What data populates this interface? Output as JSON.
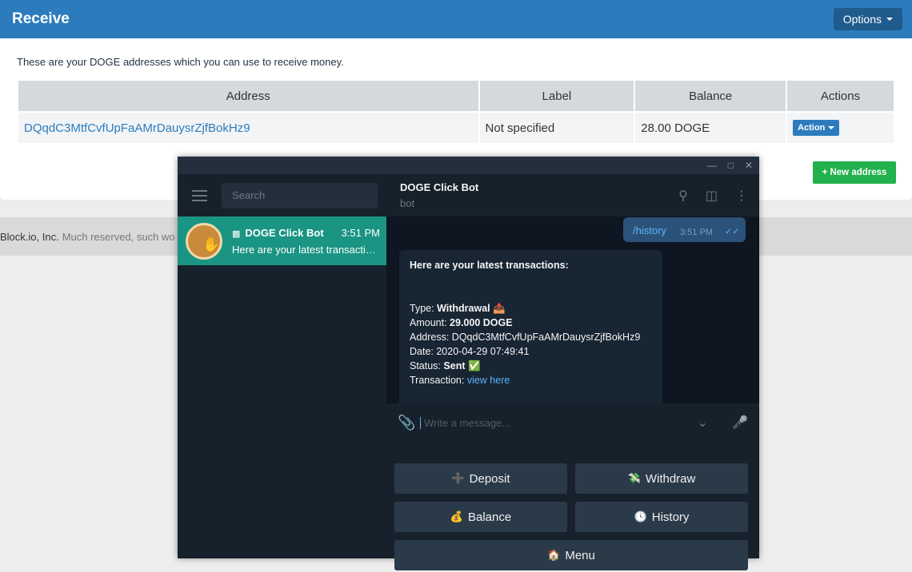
{
  "page": {
    "title": "Receive",
    "options_label": "Options",
    "intro": "These are your DOGE addresses which you can use to receive money.",
    "table": {
      "headers": [
        "Address",
        "Label",
        "Balance",
        "Actions"
      ],
      "rows": [
        {
          "address": "DQqdC3MtfCvfUpFaAMrDauysrZjfBokHz9",
          "label": "Not specified",
          "balance": "28.00 DOGE",
          "action": "Action"
        }
      ]
    },
    "new_address_label": "+ New address",
    "footer_company": "Block.io, Inc.",
    "footer_muted": "Much reserved, such wo"
  },
  "telegram": {
    "window_controls": [
      "—",
      "□",
      "✕"
    ],
    "search_placeholder": "Search",
    "chat": {
      "name": "DOGE Click Bot",
      "time": "3:51 PM",
      "preview": "Here are your latest transacti…"
    },
    "header": {
      "title": "DOGE Click Bot",
      "subtitle": "bot"
    },
    "outgoing": {
      "text": "/history",
      "time": "3:51 PM"
    },
    "incoming": {
      "heading": "Here are your latest transactions:",
      "type_label": "Type:",
      "type_value": "Withdrawal",
      "amount_label": "Amount:",
      "amount_value": "29.000 DOGE",
      "address_line": "Address: DQqdC3MtfCvfUpFaAMrDauysrZjfBokHz9",
      "date_line": "Date: 2020-04-29 07:49:41",
      "status_label": "Status:",
      "status_value": "Sent",
      "tx_label": "Transaction:",
      "tx_link": "view here"
    },
    "input_placeholder": "Write a message...",
    "keyboard": {
      "deposit": "Deposit",
      "withdraw": "Withdraw",
      "balance": "Balance",
      "history": "History",
      "menu": "Menu"
    }
  }
}
